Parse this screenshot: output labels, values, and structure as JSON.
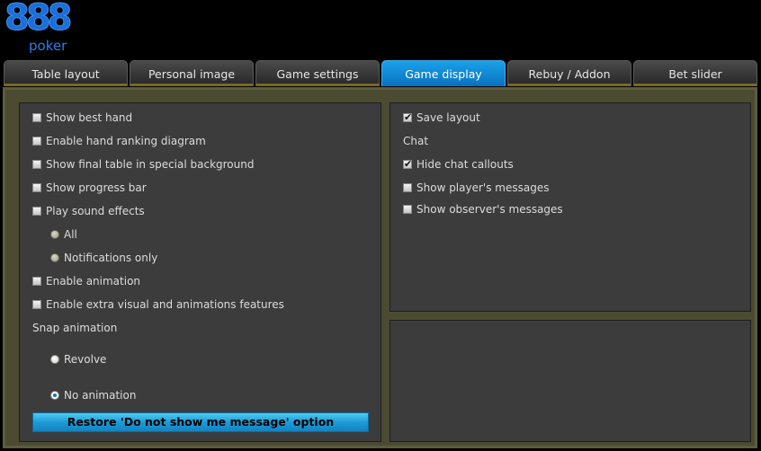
{
  "logo": {
    "number": "888",
    "word": "poker"
  },
  "tabs": [
    {
      "label": "Table layout",
      "active": false
    },
    {
      "label": "Personal image",
      "active": false
    },
    {
      "label": "Game settings",
      "active": false
    },
    {
      "label": "Game display",
      "active": true
    },
    {
      "label": "Rebuy / Addon",
      "active": false
    },
    {
      "label": "Bet slider",
      "active": false
    }
  ],
  "left": {
    "show_best_hand": {
      "label": "Show best hand",
      "checked": false
    },
    "hand_ranking": {
      "label": "Enable hand ranking diagram",
      "checked": false
    },
    "final_table_bg": {
      "label": "Show final table in special background",
      "checked": false
    },
    "progress_bar": {
      "label": "Show progress bar",
      "checked": false
    },
    "sound_effects": {
      "label": "Play sound effects",
      "checked": false
    },
    "sound_all": {
      "label": "All",
      "selected": false
    },
    "sound_notifications": {
      "label": "Notifications only",
      "selected": false
    },
    "animation": {
      "label": "Enable animation",
      "checked": false
    },
    "extra_visual": {
      "label": "Enable extra visual and animations features",
      "checked": false
    },
    "snap_label": "Snap animation",
    "snap_revolve": {
      "label": "Revolve",
      "selected": false
    },
    "snap_none": {
      "label": "No animation",
      "selected": true
    },
    "restore_button": "Restore 'Do not show me message' option"
  },
  "right": {
    "save_layout": {
      "label": "Save layout",
      "checked": true
    },
    "chat_label": "Chat",
    "hide_callouts": {
      "label": "Hide chat callouts",
      "checked": true
    },
    "players_messages": {
      "label": "Show player's messages",
      "checked": false
    },
    "observers_messages": {
      "label": "Show observer's messages",
      "checked": false
    }
  },
  "colors": {
    "accent": "#0a8ad8",
    "panel_bg": "#3c3c3c",
    "frame": "#4b4b32",
    "logo_blue": "#1a6fd8"
  }
}
